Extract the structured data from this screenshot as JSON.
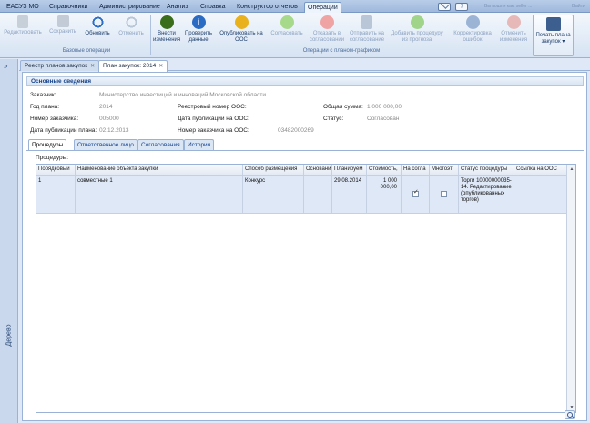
{
  "menu": {
    "items": [
      "ЕАСУЗ МО",
      "Справочники",
      "Администрирование",
      "Анализ",
      "Справка",
      "Конструктор отчетов",
      "Операции"
    ],
    "user_text": "Вы вошли как: seller ...",
    "logout": "Выйти"
  },
  "ribbon": {
    "basic": {
      "buttons": [
        "Редактировать",
        "Сохранить",
        "Обновить",
        "Отменить"
      ],
      "group_label": "Базовые операции"
    },
    "schedule": {
      "buttons": [
        "Внести изменения",
        "Проверить данные",
        "Опубликовать на ООС",
        "Согласовать",
        "Отказать в согласовании",
        "Отправить на согласование",
        "Добавить процедуру из прогноза",
        "Корректировка ошибок",
        "Отменить изменения"
      ],
      "group_label": "Операции с планом-графиком"
    },
    "print": {
      "label": "Печать плана закупок ▾"
    }
  },
  "left_panel": {
    "label": "Дерево",
    "expand": "»"
  },
  "tabs": [
    {
      "label": "Реестр планов закупок"
    },
    {
      "label": "План закупок: 2014"
    }
  ],
  "form": {
    "section_title": "Основные сведения",
    "customer_label": "Заказчик:",
    "customer_value": "Министерство инвестиций и инноваций Московской области",
    "year_label": "Год плана:",
    "year_value": "2014",
    "reg_number_label": "Реестровый номер ООС:",
    "reg_number_value": "",
    "total_label": "Общая сумма:",
    "total_value": "1 000 000,00",
    "customer_number_label": "Номер заказчика:",
    "customer_number_value": "005000",
    "pub_date_oos_label": "Дата публикации на ООС:",
    "pub_date_oos_value": "",
    "status_label": "Статус:",
    "status_value": "Согласован",
    "plan_pub_date_label": "Дата публикации плана:",
    "plan_pub_date_value": "02.12.2013",
    "oos_customer_number_label": "Номер заказчика на ООС:",
    "oos_customer_number_value": "03482000269"
  },
  "subtabs": [
    "Процедуры",
    "Ответственное лицо",
    "Согласования",
    "История"
  ],
  "procedures_label": "Процедуры:",
  "grid": {
    "columns": [
      "Порядковый",
      "Наименование объекта закупки",
      "Способ размещения",
      "Основани",
      "Планируем",
      "Стоимость,",
      "На согла",
      "Многоэт",
      "Статус процедуры",
      "Ссылка на ООС"
    ],
    "rows": [
      {
        "num": "1",
        "name": "совместные 1",
        "method": "Конкурс",
        "basis": "",
        "planned": "29.08.2014",
        "cost": "1 000 000,00",
        "agreement": true,
        "multistage": false,
        "status": "Торги 10000000035-14. Редактирование (опубликованных торгов)",
        "link": ""
      }
    ]
  }
}
